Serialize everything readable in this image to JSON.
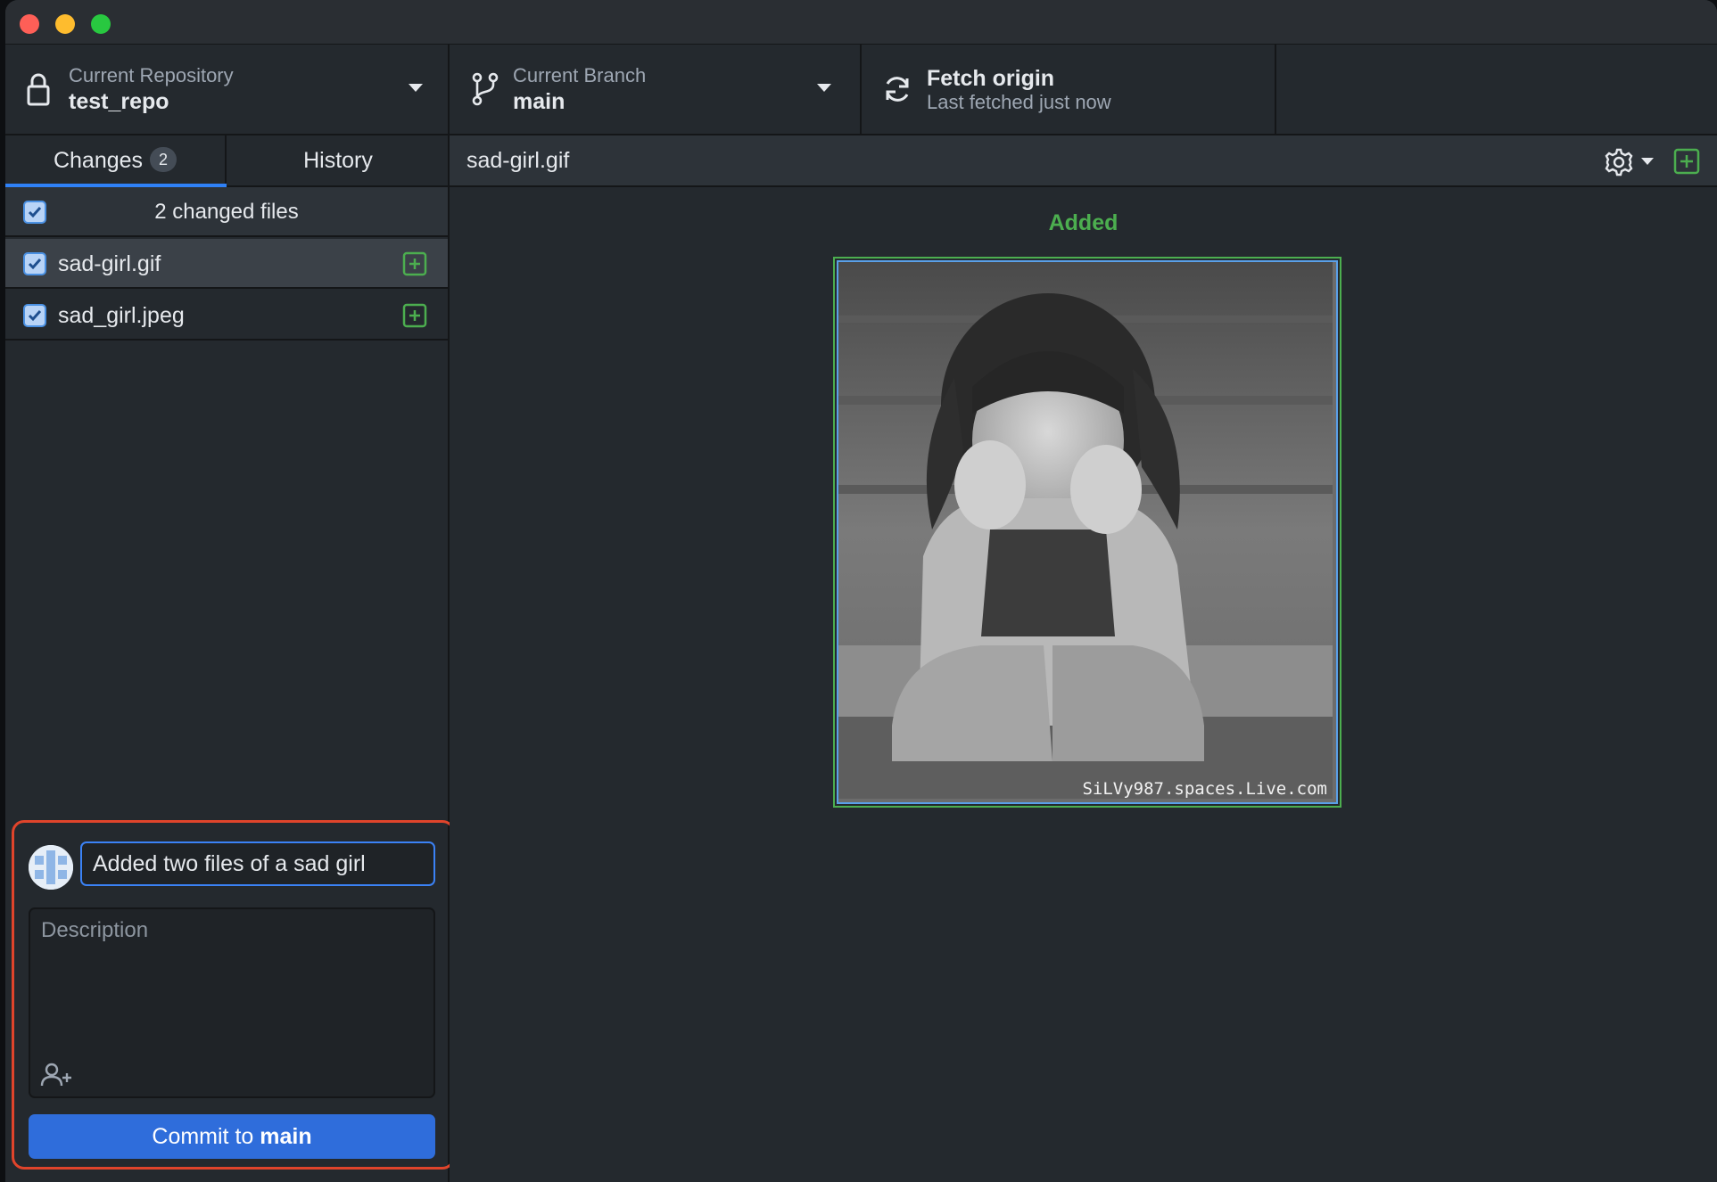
{
  "window": {
    "traffic_lights": [
      "close",
      "minimize",
      "zoom"
    ]
  },
  "toolbar": {
    "repository": {
      "label": "Current Repository",
      "value": "test_repo",
      "icon": "lock-icon"
    },
    "branch": {
      "label": "Current Branch",
      "value": "main",
      "icon": "git-branch-icon"
    },
    "fetch": {
      "label": "Fetch origin",
      "status": "Last fetched just now",
      "icon": "sync-icon"
    }
  },
  "sidebar": {
    "tabs": [
      {
        "label": "Changes",
        "count": "2",
        "active": true
      },
      {
        "label": "History",
        "active": false
      }
    ],
    "files_header": "2 changed files",
    "files": [
      {
        "name": "sad-girl.gif",
        "checked": true,
        "status": "added",
        "selected": true
      },
      {
        "name": "sad_girl.jpeg",
        "checked": true,
        "status": "added",
        "selected": false
      }
    ]
  },
  "commit": {
    "summary": "Added two files of a sad girl",
    "description_placeholder": "Description",
    "button_prefix": "Commit to",
    "button_branch": "main"
  },
  "diff": {
    "path": "sad-girl.gif",
    "status_label": "Added",
    "image_watermark": "SiLVy987.spaces.Live.com"
  },
  "colors": {
    "accent_blue": "#2f6ddb",
    "added_green": "#4cae4f",
    "highlight_red": "#e0442b"
  }
}
